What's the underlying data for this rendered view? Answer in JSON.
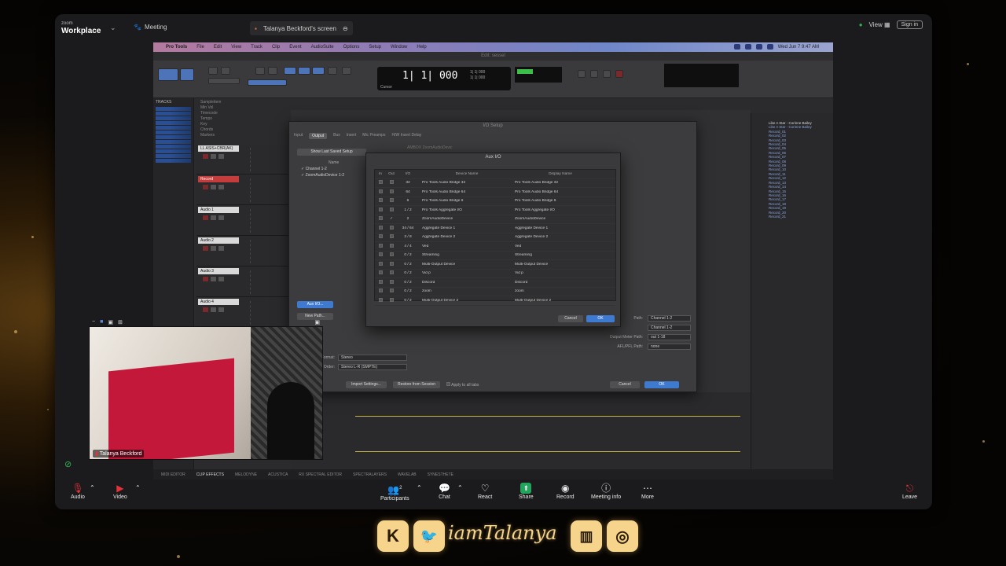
{
  "zoom": {
    "brand_top": "zoom",
    "brand_name": "Workplace",
    "meeting_label": "Meeting",
    "shared_screen_label": "Talanya Beckford's screen",
    "view_label": "View",
    "signin_label": "Sign in",
    "participant_name": "Talanya Beckford",
    "participant_count": "2",
    "toolbar": {
      "audio": "Audio",
      "video": "Video",
      "participants": "Participants",
      "chat": "Chat",
      "react": "React",
      "share": "Share",
      "record": "Record",
      "meeting_info": "Meeting info",
      "more": "More",
      "leave": "Leave"
    },
    "colors": {
      "share_green": "#21a45b",
      "leave_red": "#e5323a"
    }
  },
  "protools": {
    "menu": [
      "Pro Tools",
      "File",
      "Edit",
      "View",
      "Track",
      "Clip",
      "Event",
      "AudioSuite",
      "Options",
      "Setup",
      "Window",
      "Help"
    ],
    "clock": "Wed Jun 7  9:47 AM",
    "window_title": "Edit: sessel",
    "counter_main": "1| 1| 000",
    "counter_start": "1| 1| 000",
    "counter_end": "1| 1| 000",
    "cursor_label": "Cursor",
    "tracks_label": "TRACKS",
    "tracks": [
      {
        "name": "LL ASIS+CBR(AK)"
      },
      {
        "name": "Record"
      },
      {
        "name": "Audio 1"
      },
      {
        "name": "Audio 2"
      },
      {
        "name": "Audio 3"
      },
      {
        "name": "Audio 4"
      }
    ],
    "clip_list": [
      "Sampleitem",
      "Min Vol",
      "Timecode",
      "Tempo",
      "Key",
      "Chords",
      "Markers"
    ],
    "right_list": [
      "Like A Star - Corinne Bailey",
      "Like A Star - Corinne Bailey",
      "Record_01",
      "Record_02",
      "Record_03",
      "Record_04",
      "Record_05",
      "Record_06",
      "Record_07",
      "Record_08",
      "Record_09",
      "Record_10",
      "Record_11",
      "Record_12",
      "Record_13",
      "Record_14",
      "Record_15",
      "Record_16",
      "Record_17",
      "Record_18",
      "Record_19",
      "Record_20",
      "Record_21"
    ],
    "bottom_bar": [
      "MIDI EDITOR",
      "CLIP EFFECTS",
      "MELODYNE",
      "ACUSTICA",
      "RX SPECTRAL EDITOR",
      "SPECTRALAYERS",
      "WAVELAB",
      "SYNESTHETE"
    ]
  },
  "io_setup": {
    "title": "I/O Setup",
    "tabs": [
      "Input",
      "Output",
      "Bus",
      "Insert",
      "Mic Preamps",
      "H/W Insert Delay"
    ],
    "active_tab": "Output",
    "show_last_saved": "Show Last Saved Setup",
    "name_header": "Name",
    "list": [
      "Channel 1-2",
      "ZoomAudioDevice 1-2"
    ],
    "new_path": "New Path...",
    "aux_io": "Aux I/O...",
    "format_label": "Format:",
    "format_value": "Stereo",
    "order_label": "Order:",
    "order_value": "Stereo L-R (SMPTE)",
    "import_btn": "Import Settings...",
    "restore_btn": "Restore from Session",
    "apply_all": "Apply to all tabs",
    "cancel": "Cancel",
    "ok": "OK",
    "right_fields": [
      {
        "label": "Path:",
        "value": "Channel 1-2"
      },
      {
        "label": "",
        "value": "Channel 1-2"
      },
      {
        "label": "Output Meter Path:",
        "value": "out 1-18"
      },
      {
        "label": "AFL/PFL Path:",
        "value": "none"
      }
    ],
    "device_banner": "AMBOX ZoomAudioDevic"
  },
  "aux_io": {
    "title": "Aux I/O",
    "headers": {
      "in": "In",
      "out": "Out",
      "io": "I/O",
      "device": "Device Name",
      "display": "Display Name"
    },
    "rows": [
      {
        "io": "32",
        "device": "Pro Tools Audio Bridge 32",
        "display": "Pro Tools Audio Bridge 32",
        "checked": false
      },
      {
        "io": "64",
        "device": "Pro Tools Audio Bridge 64",
        "display": "Pro Tools Audio Bridge 64",
        "checked": false
      },
      {
        "io": "6",
        "device": "Pro Tools Audio Bridge 6",
        "display": "Pro Tools Audio Bridge 6",
        "checked": false
      },
      {
        "io": "1 / 2",
        "device": "Pro Tools Aggregate I/O",
        "display": "Pro Tools Aggregate I/O",
        "checked": false
      },
      {
        "io": "2",
        "device": "ZoomAudioDevice",
        "display": "ZoomAudioDevice",
        "checked": true
      },
      {
        "io": "34 / 64",
        "device": "Aggregate Device 1",
        "display": "Aggregate Device 1",
        "checked": false
      },
      {
        "io": "3 / 8",
        "device": "Aggregate Device 2",
        "display": "Aggregate Device 2",
        "checked": false
      },
      {
        "io": "4 / 4",
        "device": "Ved",
        "display": "Ved",
        "checked": false
      },
      {
        "io": "0 / 2",
        "device": "Streaming",
        "display": "Streaming",
        "checked": false
      },
      {
        "io": "0 / 2",
        "device": "Multi-Output Device",
        "display": "Multi-Output Device",
        "checked": false
      },
      {
        "io": "0 / 2",
        "device": "Vid p",
        "display": "Vid p",
        "checked": false
      },
      {
        "io": "0 / 2",
        "device": "Discord",
        "display": "Discord",
        "checked": false
      },
      {
        "io": "0 / 2",
        "device": "zoom",
        "display": "zoom",
        "checked": false
      },
      {
        "io": "0 / 2",
        "device": "Multi-Output Device 2",
        "display": "Multi-Output Device 2",
        "checked": false
      }
    ],
    "cancel": "Cancel",
    "ok": "OK"
  },
  "overlay": {
    "handle": "iamTalanya",
    "social_icons": [
      "kick-icon",
      "twitter-icon",
      "twitch-icon",
      "instagram-icon"
    ]
  }
}
